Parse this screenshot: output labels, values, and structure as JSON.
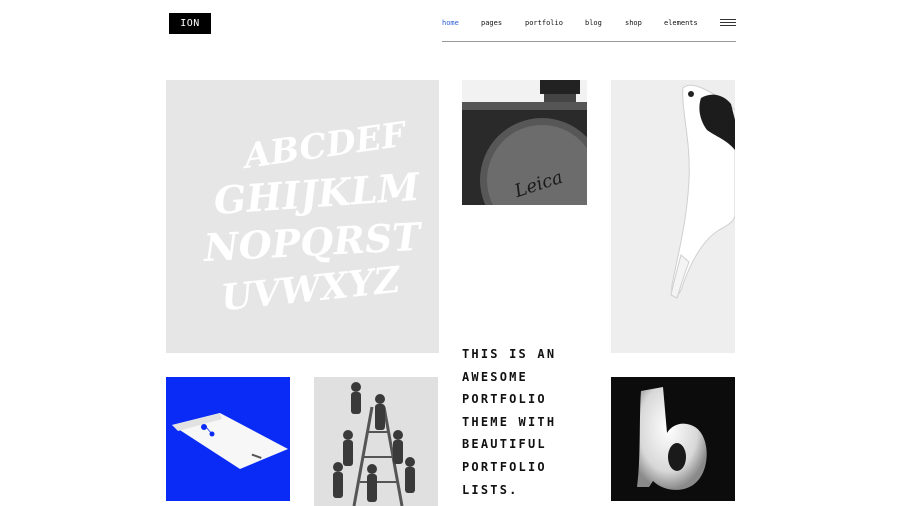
{
  "header": {
    "logo_text": "ION",
    "nav": [
      {
        "label": "home",
        "active": true
      },
      {
        "label": "pages",
        "active": false
      },
      {
        "label": "portfolio",
        "active": false
      },
      {
        "label": "blog",
        "active": false
      },
      {
        "label": "shop",
        "active": false
      },
      {
        "label": "elements",
        "active": false
      }
    ],
    "menu_icon": "hamburger-icon"
  },
  "tagline": "THIS IS AN\nAWESOME\nPORTFOLIO\nTHEME WITH\nBEAUTIFUL\nPORTFOLIO\nLISTS.",
  "portfolio": {
    "alphabet_letters": [
      "ABCDEF",
      "GHIJKLM",
      "NOPQRST",
      "UVWXYZ"
    ],
    "camera_brand": "Leica",
    "letter_sculpture": "b"
  },
  "colors": {
    "accent": "#2b5cd6",
    "logo_bg": "#000000",
    "envelope_bg": "#0a2bf5"
  }
}
